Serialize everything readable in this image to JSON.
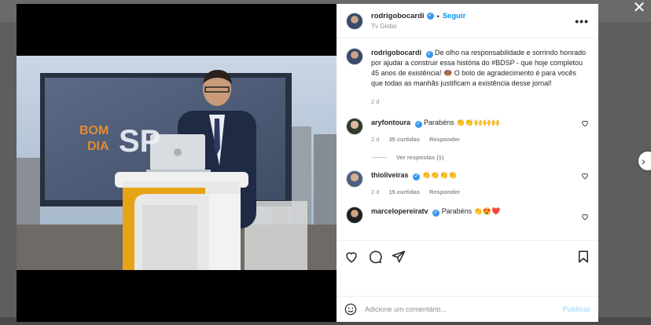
{
  "close_icon": "✕",
  "next_icon": "›",
  "post": {
    "author": "rodrigobocardi",
    "follow_label": "Seguir",
    "separator": "•",
    "location": "Tv Globo",
    "more_icon": "•••",
    "caption": {
      "username": "rodrigobocardi",
      "text": "De olho na responsabilidade e sorrindo honrado por ajudar a construir essa história do #BDSP - que hoje completou 45 anos de existência! 🍩 O bolo de agradecimento é para vocês que todas as manhãs justificam a existência desse jornal!",
      "time": "2 d"
    },
    "image_text": {
      "screen_line1": "BOM",
      "screen_line2": "DIA",
      "screen_logo": "SP"
    }
  },
  "comments": [
    {
      "username": "aryfontoura",
      "text": "Parabéns 👏👏🙌🙌🙌",
      "time": "2 d",
      "likes": "35 curtidas",
      "reply_label": "Responder",
      "replies_label": "Ver respostas (1)"
    },
    {
      "username": "thioliveiras",
      "text": "👏👏👏👏",
      "time": "2 d",
      "likes": "15 curtidas",
      "reply_label": "Responder"
    },
    {
      "username": "marcelopereiratv",
      "text": "Parabéns 👏😍❤️"
    }
  ],
  "composer": {
    "placeholder": "Adicione um comentário...",
    "publish_label": "Publicar"
  },
  "colors": {
    "accent": "#0095f6",
    "verified": "#3897f0",
    "muted": "#8e8e8e"
  }
}
